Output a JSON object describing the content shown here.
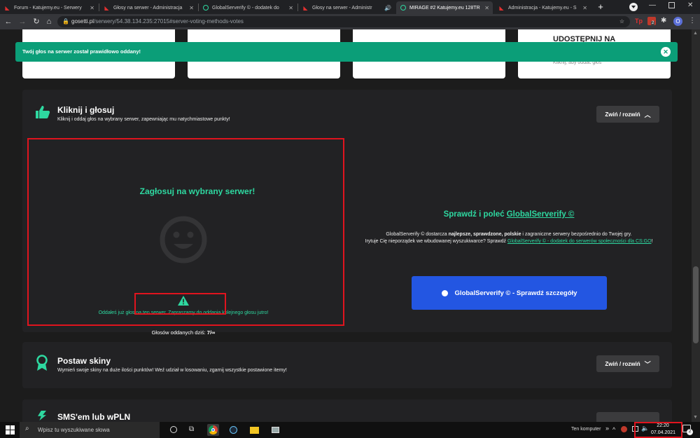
{
  "tabs": [
    {
      "title": "Forum - Katujemy.eu - Serwery"
    },
    {
      "title": "Głosy na serwer - Administracja"
    },
    {
      "title": "GlobalServerify © - dodatek do"
    },
    {
      "title": "Głosy na serwer - Administr"
    },
    {
      "title": "MIRAGE #2 Katujemy.eu 128TR"
    },
    {
      "title": "Administracja - Katujemy.eu - S"
    }
  ],
  "address": {
    "domain": "gosetti.pl",
    "path": "/serwery/54.38.134.235:27015#server-voting-methods-votes"
  },
  "extensions": {
    "badge_count": "2",
    "profile_initial": "O"
  },
  "top_card": {
    "title": "UDOSTĘPNIJ NA",
    "subtitle": "Kliknij, aby oddać głos"
  },
  "alert": {
    "text": "Twój głos na serwer został prawidłowo oddany!"
  },
  "section_vote": {
    "title": "Kliknij i głosuj",
    "description": "Kliknij i oddaj głos na wybrany serwer, zapewniając mu natychmiastowe punkty!",
    "toggle_label": "Zwiń / rozwiń",
    "left_heading": "Zagłosuj na wybrany serwer!",
    "warning_text": "Oddałeś już głos na ten serwer. Zapraszamy do oddania kolejnego głosu jutro!",
    "votes_label": "Głosów oddanych dziś:",
    "votes_value": "7/∞",
    "right_heading_prefix": "Sprawdź i poleć",
    "right_heading_link": "GlobalServerify ©",
    "desc_line1_a": "GlobalServerify © dostarcza ",
    "desc_line1_b": "najlepsze, sprawdzone, polskie",
    "desc_line1_c": " i zagraniczne serwery bezpośrednio do Twojej gry.",
    "desc_line2": "Irytuje Cię nieporządek we wbudowanej wyszukiwarce? Sprawdź ",
    "desc_link": "GlobalServerify © - dodatek do serwerów społeczności dla CS:GO",
    "desc_end": "!",
    "button_label": "GlobalServerify © - Sprawdź szczegóły"
  },
  "section_skins": {
    "title": "Postaw skiny",
    "description": "Wymień swoje skiny na duże ilości punktów! Weź udział w losowaniu, zgarnij wszystkie postawione itemy!",
    "toggle_label": "Zwiń / rozwiń"
  },
  "section_sms": {
    "title": "SMS'em lub wPLN"
  },
  "taskbar": {
    "search_placeholder": "Wpisz tu wyszukiwane słowa",
    "computer_label": "Ten komputer",
    "time": "22:20",
    "date": "07.04.2021",
    "notification_count": "2"
  },
  "colors": {
    "accent_green": "#2ed8a0",
    "alert_green": "#0b9e78",
    "button_blue": "#2356e2",
    "highlight_red": "#e0141e"
  }
}
